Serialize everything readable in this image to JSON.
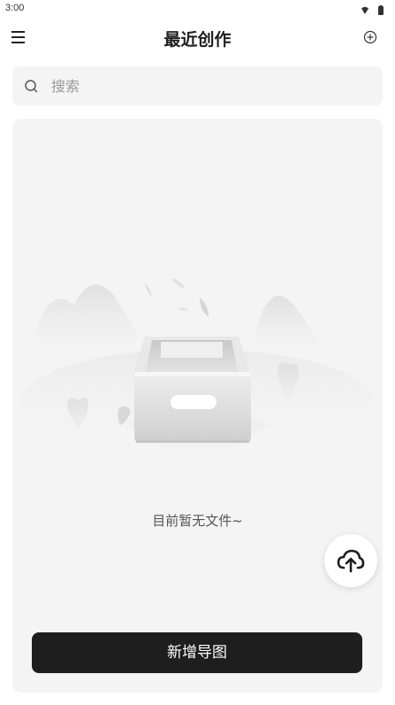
{
  "status_bar": {
    "time": "3:00",
    "icons": [
      "wifi-icon",
      "battery-icon"
    ]
  },
  "header": {
    "title": "最近创作",
    "menu_icon": "hamburger-menu-icon",
    "add_icon": "add-circle-icon"
  },
  "search": {
    "placeholder": "搜索",
    "value": "",
    "icon": "search-icon"
  },
  "empty_state": {
    "message": "目前暂无文件~",
    "illustration": "empty-box-illustration"
  },
  "upload_button": {
    "icon": "cloud-upload-icon"
  },
  "primary_action": {
    "label": "新增导图"
  },
  "colors": {
    "background": "#ffffff",
    "card": "#f4f4f4",
    "primary_button": "#1e1e1e",
    "primary_text": "#ffffff",
    "muted_text": "#9a9a9a"
  }
}
